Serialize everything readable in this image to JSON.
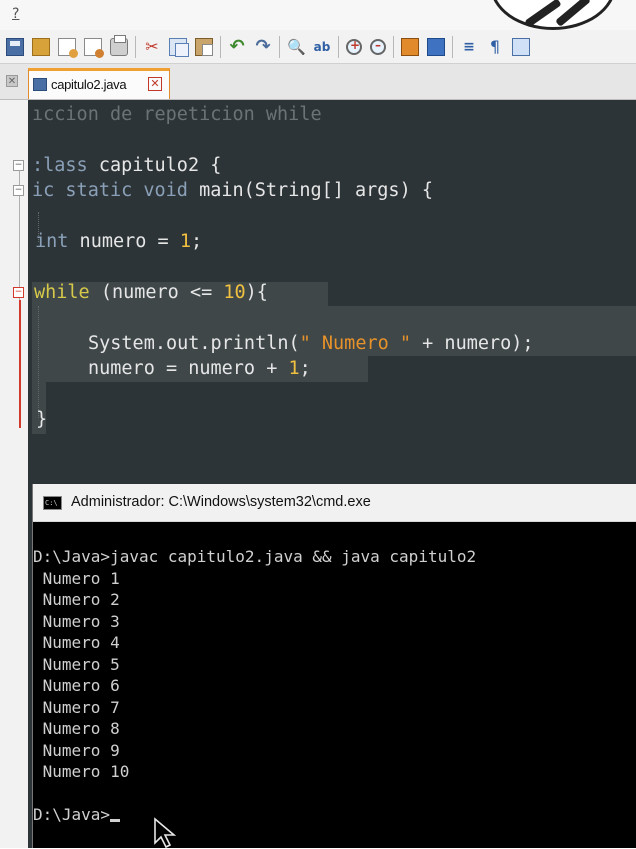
{
  "menubar": {
    "help_mark": "?"
  },
  "tab": {
    "label": "capitulo2.java",
    "close_glyph": "✕"
  },
  "editor": {
    "lines": {
      "comment": "ıccion de repeticion while",
      "class_kw": ":lass",
      "class_name": " capitulo2 {",
      "method_kw1": "ic static",
      "method_kw2": " void",
      "method_rest": " main(String[] args) {",
      "int_kw": "int",
      "int_rest": " numero = ",
      "int_val": "1",
      "int_end": ";",
      "while_kw": "while",
      "while_rest": " (numero <= ",
      "while_val": "10",
      "while_end": "){",
      "println_pre": "System.out.println(",
      "println_str": "\" Numero \"",
      "println_post": " + numero);",
      "assign_pre": "numero = numero + ",
      "assign_val": "1",
      "assign_end": ";",
      "close_brace": "}"
    }
  },
  "cmd": {
    "title": "Administrador: C:\\Windows\\system32\\cmd.exe",
    "icon_text": "C:\\",
    "command_line": "D:\\Java>javac capitulo2.java && java capitulo2",
    "output": [
      " Numero 1",
      " Numero 2",
      " Numero 3",
      " Numero 4",
      " Numero 5",
      " Numero 6",
      " Numero 7",
      " Numero 8",
      " Numero 9",
      " Numero 10"
    ],
    "prompt": "D:\\Java>"
  },
  "colors": {
    "editor_bg": "#2d3437",
    "keyword": "#8aa0b8",
    "number": "#f0c040",
    "string": "#e8922a",
    "tab_accent": "#f0a030"
  }
}
